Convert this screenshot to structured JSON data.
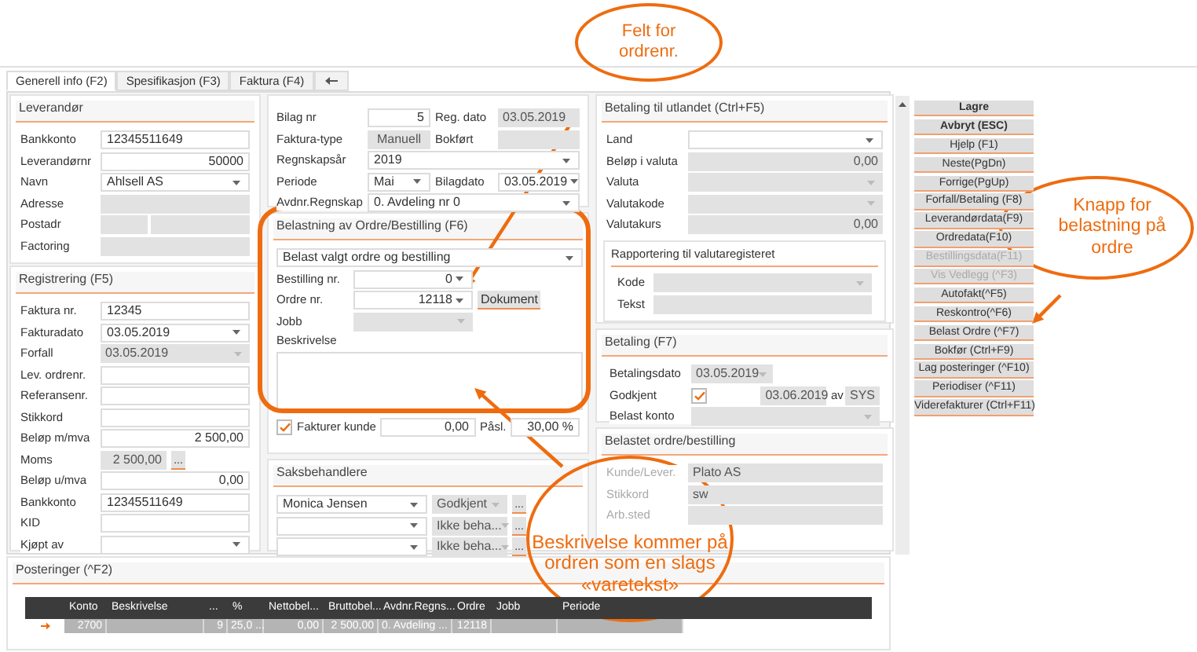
{
  "tabs": [
    {
      "kind": "text",
      "label": "Generell info (F2)",
      "selected": true
    },
    {
      "kind": "text",
      "label": "Spesifikasjon (F3)",
      "selected": false
    },
    {
      "kind": "text",
      "label": "Faktura (F4)",
      "selected": false
    },
    {
      "kind": "icon",
      "selected": false
    }
  ],
  "leverandor": {
    "title": "Leverandør",
    "fields": [
      {
        "label": "Bankkonto",
        "kind": "text",
        "value": "12345511649"
      },
      {
        "label": "Leverandørnr",
        "kind": "number",
        "value": "50000"
      },
      {
        "label": "Navn",
        "kind": "select",
        "value": "Ahlsell AS"
      },
      {
        "label": "Adresse",
        "kind": "readonly"
      },
      {
        "label": "Postadr",
        "kind": "readonly_pair"
      },
      {
        "label": "Factoring",
        "kind": "readonly"
      }
    ]
  },
  "registrering": {
    "title": "Registrering (F5)",
    "fields": [
      {
        "label": "Faktura nr.",
        "kind": "text",
        "value": "12345"
      },
      {
        "label": "Fakturadato",
        "kind": "select",
        "value": "03.05.2019"
      },
      {
        "label": "Forfall",
        "kind": "readonly_select",
        "value": "03.05.2019"
      },
      {
        "label": "Lev. ordrenr.",
        "kind": "text"
      },
      {
        "label": "Referansenr.",
        "kind": "text"
      },
      {
        "label": "Stikkord",
        "kind": "text"
      },
      {
        "label": "Beløp m/mva",
        "kind": "number",
        "value": "2 500,00"
      },
      {
        "label": "Moms",
        "kind": "readonly_more",
        "value": "2 500,00",
        "button": "..."
      },
      {
        "label": "Beløp u/mva",
        "kind": "number",
        "value": "0,00"
      },
      {
        "label": "Bankkonto",
        "kind": "text",
        "value": "12345511649"
      },
      {
        "label": "KID",
        "kind": "text"
      },
      {
        "label": "Kjøpt av",
        "kind": "select"
      }
    ]
  },
  "bilag": {
    "rows": [
      {
        "label": "Bilag nr",
        "field": {
          "kind": "number",
          "value": "5"
        },
        "label_2": "Reg. dato",
        "field_2": {
          "kind": "readonly",
          "value": "03.05.2019"
        }
      },
      {
        "label": "Faktura-type",
        "field": {
          "kind": "readonly_center",
          "value": "Manuell"
        },
        "label_2": "Bokført",
        "field_2": {
          "kind": "readonly"
        }
      },
      {
        "label": "Regnskapsår",
        "field": {
          "kind": "select",
          "value": "2019"
        }
      },
      {
        "label": "Periode",
        "field": {
          "kind": "select",
          "value": "Mai"
        },
        "label_2": "Bilagdato",
        "field_2": {
          "kind": "select",
          "value": "03.05.2019"
        }
      },
      {
        "label": "Avdnr.Regnskap",
        "field": {
          "kind": "select",
          "value": "0.  Avdeling nr 0"
        }
      }
    ]
  },
  "belastning": {
    "title": "Belastning av Ordre/Bestilling (F6)",
    "mode": {
      "kind": "select",
      "value": "Belast valgt ordre og bestilling"
    },
    "fields": [
      {
        "label": "Bestilling nr.",
        "kind": "select_number",
        "value": "0"
      },
      {
        "label": "Ordre nr.",
        "kind": "select_number",
        "value": "12118",
        "button": "Dokument"
      },
      {
        "label": "Jobb",
        "kind": "readonly_select"
      }
    ],
    "description_label": "Beskrivelse",
    "invoice_customer": {
      "label": "Fakturer kunde",
      "checked": true,
      "value": "0,00",
      "markup_label": "Påsl.",
      "markup": "30,00 %"
    }
  },
  "saksbehandlere": {
    "title": "Saksbehandlere",
    "rows": [
      {
        "name": "Monica Jensen",
        "status": "Godkjent",
        "button": "..."
      },
      {
        "status": "Ikke beha...",
        "button": "..."
      },
      {
        "status": "Ikke beha...",
        "button": "..."
      }
    ]
  },
  "utland": {
    "title": "Betaling til utlandet (Ctrl+F5)",
    "fields": [
      {
        "label": "Land",
        "kind": "select"
      },
      {
        "label": "Beløp i valuta",
        "kind": "readonly_number",
        "value": "0,00"
      },
      {
        "label": "Valuta",
        "kind": "readonly_select"
      },
      {
        "label": "Valutakode",
        "kind": "readonly_select"
      },
      {
        "label": "Valutakurs",
        "kind": "readonly_number",
        "value": "0,00"
      }
    ],
    "reporting": {
      "title": "Rapportering til valutaregisteret",
      "fields": [
        {
          "label": "Kode",
          "kind": "readonly_select"
        },
        {
          "label": "Tekst",
          "kind": "readonly"
        }
      ]
    }
  },
  "betaling": {
    "title": "Betaling (F7)",
    "date_label": "Betalingsdato",
    "date": "03.05.2019",
    "approved_label": "Godkjent",
    "approved": true,
    "approved_date": "03.06.2019",
    "by_label": "av",
    "by": "SYS",
    "account_label": "Belast konto"
  },
  "belastet": {
    "title": "Belastet ordre/bestilling",
    "fields": [
      {
        "label": "Kunde/Lever.",
        "kind": "readonly",
        "value": "Plato AS",
        "disabled": true
      },
      {
        "label": "Stikkord",
        "kind": "readonly",
        "value": "sw",
        "disabled": true
      },
      {
        "label": "Arb.sted",
        "kind": "readonly",
        "disabled": true
      }
    ]
  },
  "buttons": [
    {
      "label": "Lagre",
      "kind": "primary",
      "disabled": false
    },
    {
      "label": "Avbryt (ESC)",
      "kind": "primary",
      "disabled": false
    },
    {
      "label": "Hjelp (F1)",
      "kind": "normal",
      "disabled": false
    },
    {
      "label": "Neste(PgDn)",
      "kind": "normal",
      "disabled": false
    },
    {
      "label": "Forrige(PgUp)",
      "kind": "normal",
      "disabled": false
    },
    {
      "label": "Forfall/Betaling (F8)",
      "kind": "normal",
      "disabled": false
    },
    {
      "label": "Leverandørdata(F9)",
      "kind": "normal",
      "disabled": false
    },
    {
      "label": "Ordredata(F10)",
      "kind": "normal",
      "disabled": false
    },
    {
      "label": "Bestillingsdata(F11)",
      "kind": "normal",
      "disabled": true
    },
    {
      "label": "Vis Vedlegg (^F3)",
      "kind": "normal",
      "disabled": true
    },
    {
      "label": "Autofakt(^F5)",
      "kind": "normal",
      "disabled": false
    },
    {
      "label": "Reskontro(^F6)",
      "kind": "normal",
      "disabled": false
    },
    {
      "label": "Belast Ordre (^F7)",
      "kind": "normal",
      "disabled": false
    },
    {
      "label": "Bokfør (Ctrl+F9)",
      "kind": "normal",
      "disabled": false
    },
    {
      "label": "Lag posteringer (^F10)",
      "kind": "normal",
      "disabled": false
    },
    {
      "label": "Periodiser (^F11)",
      "kind": "normal",
      "disabled": false
    },
    {
      "label": "Viderefakturer (Ctrl+F11)",
      "kind": "normal",
      "disabled": false
    }
  ],
  "posteringer": {
    "title": "Posteringer (^F2)",
    "columns": [
      "Konto",
      "Beskrivelse",
      "...",
      "%",
      "Nettobel...",
      "Bruttobel...",
      "Avdnr.Regns...",
      "Ordre",
      "Jobb",
      "Periode"
    ],
    "rows": [
      {
        "current": true,
        "cells": [
          "2700",
          null,
          "9",
          "25,0 ...",
          "0,00",
          "2 500,00",
          "0.  Avdeling ...",
          "12118",
          null,
          null
        ]
      }
    ]
  },
  "annotations": [
    {
      "text": "Felt for ordrenr."
    },
    {
      "text": "Knapp for belastning på ordre"
    },
    {
      "text": "Beskrivelse kommer på ordren som en slags «varetekst»"
    }
  ]
}
